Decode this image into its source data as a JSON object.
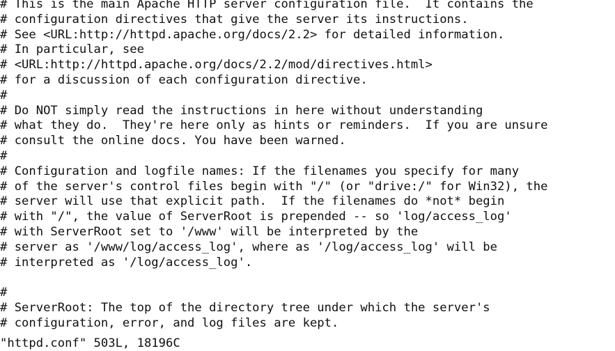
{
  "terminal": {
    "app": "vim",
    "background_color": "#ffffff",
    "foreground_color": "#101010",
    "file_type": "apache-httpd-config"
  },
  "buffer": {
    "lines": [
      "# This is the main Apache HTTP server configuration file.  It contains the",
      "# configuration directives that give the server its instructions.",
      "# See <URL:http://httpd.apache.org/docs/2.2> for detailed information.",
      "# In particular, see",
      "# <URL:http://httpd.apache.org/docs/2.2/mod/directives.html>",
      "# for a discussion of each configuration directive.",
      "#",
      "# Do NOT simply read the instructions in here without understanding",
      "# what they do.  They're here only as hints or reminders.  If you are unsure",
      "# consult the online docs. You have been warned.",
      "#",
      "# Configuration and logfile names: If the filenames you specify for many",
      "# of the server's control files begin with \"/\" (or \"drive:/\" for Win32), the",
      "# server will use that explicit path.  If the filenames do *not* begin",
      "# with \"/\", the value of ServerRoot is prepended -- so 'log/access_log'",
      "# with ServerRoot set to '/www' will be interpreted by the",
      "# server as '/www/log/access_log', where as '/log/access_log' will be",
      "# interpreted as '/log/access_log'.",
      "",
      "#",
      "# ServerRoot: The top of the directory tree under which the server's",
      "# configuration, error, and log files are kept."
    ]
  },
  "statusline": {
    "text": "\"httpd.conf\" 503L, 18196C",
    "filename": "httpd.conf",
    "line_count": "503L",
    "char_count": "18196C"
  }
}
